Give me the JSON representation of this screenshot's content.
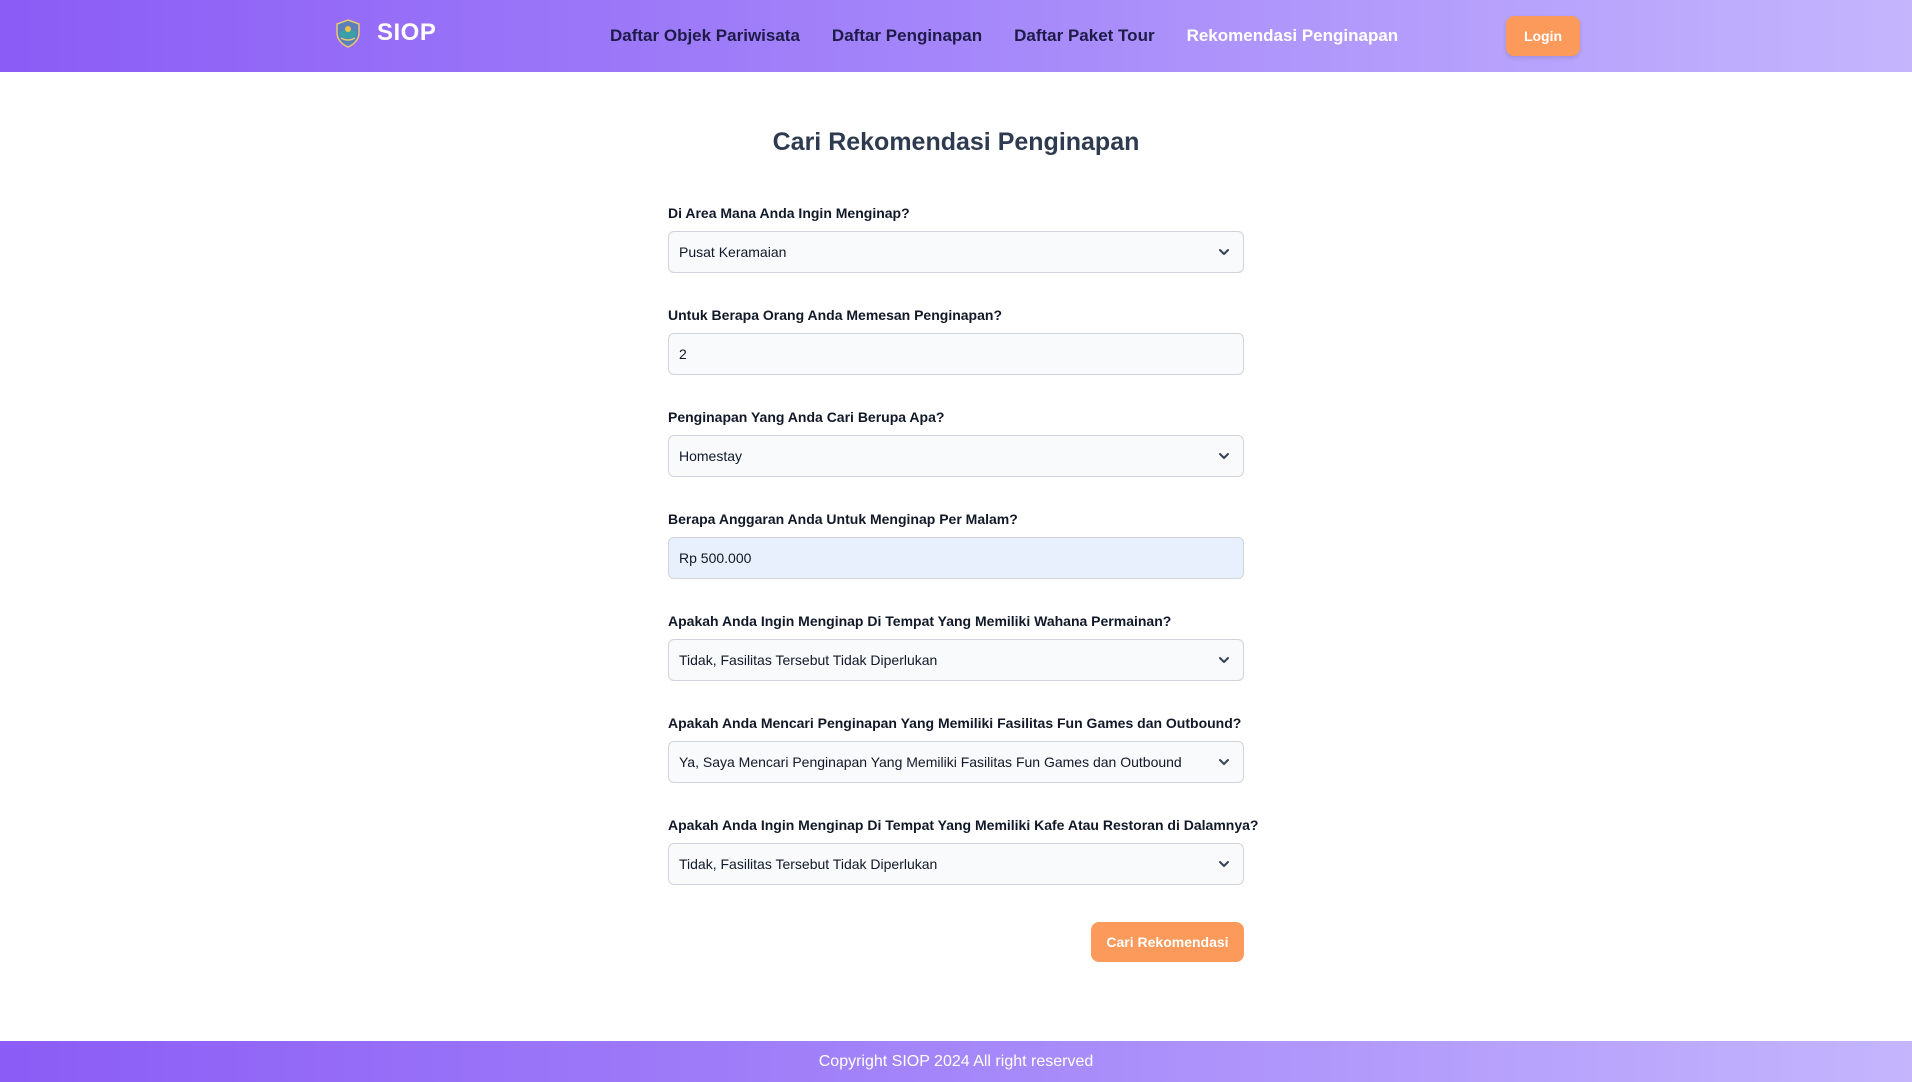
{
  "header": {
    "brand": "SIOP",
    "logo_icon": "siop-logo-icon",
    "nav": [
      {
        "label": "Daftar Objek Pariwisata"
      },
      {
        "label": "Daftar Penginapan"
      },
      {
        "label": "Daftar Paket Tour"
      },
      {
        "label": "Rekomendasi Penginapan",
        "active": true
      }
    ],
    "login_label": "Login"
  },
  "main": {
    "title": "Cari Rekomendasi Penginapan",
    "fields": [
      {
        "label": "Di Area Mana Anda Ingin Menginap?",
        "value": "Pusat Keramaian",
        "type": "select"
      },
      {
        "label": "Untuk Berapa Orang Anda Memesan Penginapan?",
        "value": "2",
        "type": "input"
      },
      {
        "label": "Penginapan Yang Anda Cari Berupa Apa?",
        "value": "Homestay",
        "type": "select"
      },
      {
        "label": "Berapa Anggaran Anda Untuk Menginap Per Malam?",
        "value": "Rp 500.000",
        "type": "input"
      },
      {
        "label": "Apakah Anda Ingin Menginap Di Tempat Yang Memiliki Wahana Permainan?",
        "value": "Tidak, Fasilitas Tersebut Tidak Diperlukan",
        "type": "select"
      },
      {
        "label": "Apakah Anda Mencari Penginapan Yang Memiliki Fasilitas Fun Games dan Outbound?",
        "value": "Ya, Saya Mencari Penginapan Yang Memiliki Fasilitas Fun Games dan Outbound",
        "type": "select"
      },
      {
        "label": "Apakah Anda Ingin Menginap Di Tempat Yang Memiliki Kafe Atau Restoran di Dalamnya?",
        "value": "Tidak, Fasilitas Tersebut Tidak Diperlukan",
        "type": "select"
      }
    ],
    "submit_label": "Cari Rekomendasi"
  },
  "footer": {
    "copyright": "Copyright SIOP 2024 All right reserved"
  },
  "colors": {
    "header_gradient_start": "#8b5cf6",
    "header_gradient_end": "#c4b5fd",
    "button_orange": "#fb9a5a",
    "title": "#2d3a4f"
  }
}
